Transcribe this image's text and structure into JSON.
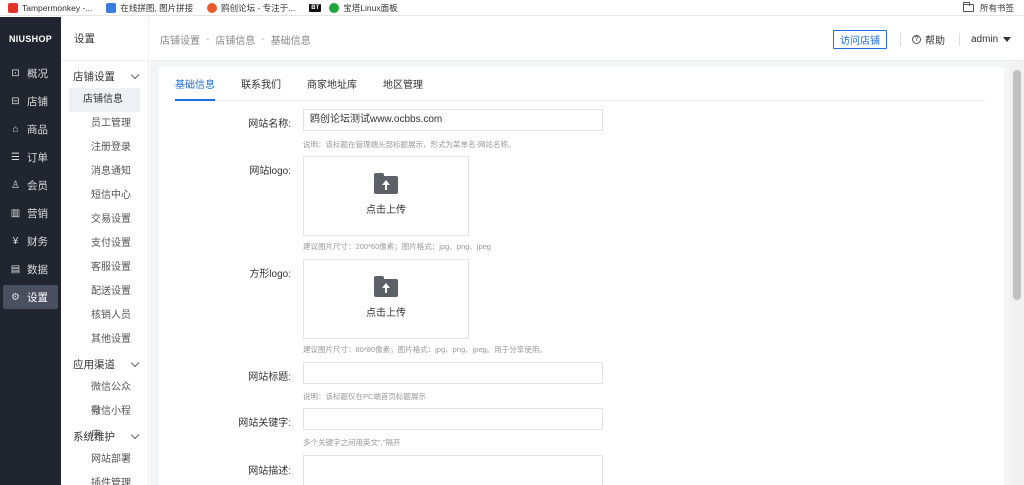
{
  "bookmarks": {
    "items": [
      {
        "label": "Tampermonkey -...",
        "color": "#e0342a"
      },
      {
        "label": "在线拼图, 图片拼接",
        "color": "#3b7ddd"
      },
      {
        "label": "鸥创论坛 - 专注于...",
        "color": "#e85c2b"
      },
      {
        "label": "宝塔Linux面板",
        "color": "#20a53a"
      }
    ],
    "bt_label": "BT",
    "all_bookmarks": "所有书签"
  },
  "sidebar": {
    "logo": "NIUSHOP",
    "items": [
      {
        "label": "概况",
        "icon": "⊡"
      },
      {
        "label": "店铺",
        "icon": "⊟"
      },
      {
        "label": "商品",
        "icon": "⌂"
      },
      {
        "label": "订单",
        "icon": "☰"
      },
      {
        "label": "会员",
        "icon": "♙"
      },
      {
        "label": "营销",
        "icon": "▥"
      },
      {
        "label": "财务",
        "icon": "¥"
      },
      {
        "label": "数据",
        "icon": "▤"
      },
      {
        "label": "设置",
        "icon": "⚙"
      }
    ],
    "active_index": 8
  },
  "subnav": {
    "title": "设置",
    "groups": [
      {
        "title": "店铺设置",
        "items": [
          "店铺信息",
          "员工管理",
          "注册登录",
          "消息通知",
          "短信中心",
          "交易设置",
          "支付设置",
          "客服设置",
          "配送设置",
          "核销人员",
          "其他设置"
        ]
      },
      {
        "title": "应用渠道",
        "items": [
          "微信公众号",
          "微信小程序"
        ]
      },
      {
        "title": "系统维护",
        "items": [
          "网站部署",
          "插件管理"
        ]
      }
    ],
    "active_item": "店铺信息"
  },
  "header": {
    "breadcrumb": [
      "店铺设置",
      "店铺信息",
      "基础信息"
    ],
    "visit_button": "访问店铺",
    "help": "帮助",
    "user": "admin"
  },
  "tabs": [
    "基础信息",
    "联系我们",
    "商家地址库",
    "地区管理"
  ],
  "form": {
    "site_name_label": "网站名称:",
    "site_name_value": "鸥创论坛测试www.ocbbs.com",
    "site_name_hint": "说明：该标题在管理端头部标题展示，形式为菜单名-网站名称。",
    "logo_label": "网站logo:",
    "logo_upload": "点击上传",
    "logo_hint": "建议图片尺寸：200*60像素；图片格式：jpg、png、jpeg",
    "square_logo_label": "方形logo:",
    "square_logo_upload": "点击上传",
    "square_logo_hint": "建议图片尺寸：80*80像素；图片格式：jpg、png、jpeg。用于分享使用。",
    "site_title_label": "网站标题:",
    "site_title_hint": "说明：该标题仅在PC端首页标题展示",
    "keywords_label": "网站关键字:",
    "keywords_hint": "多个关键字之间用英文\",\"隔开",
    "description_label": "网站描述:"
  }
}
